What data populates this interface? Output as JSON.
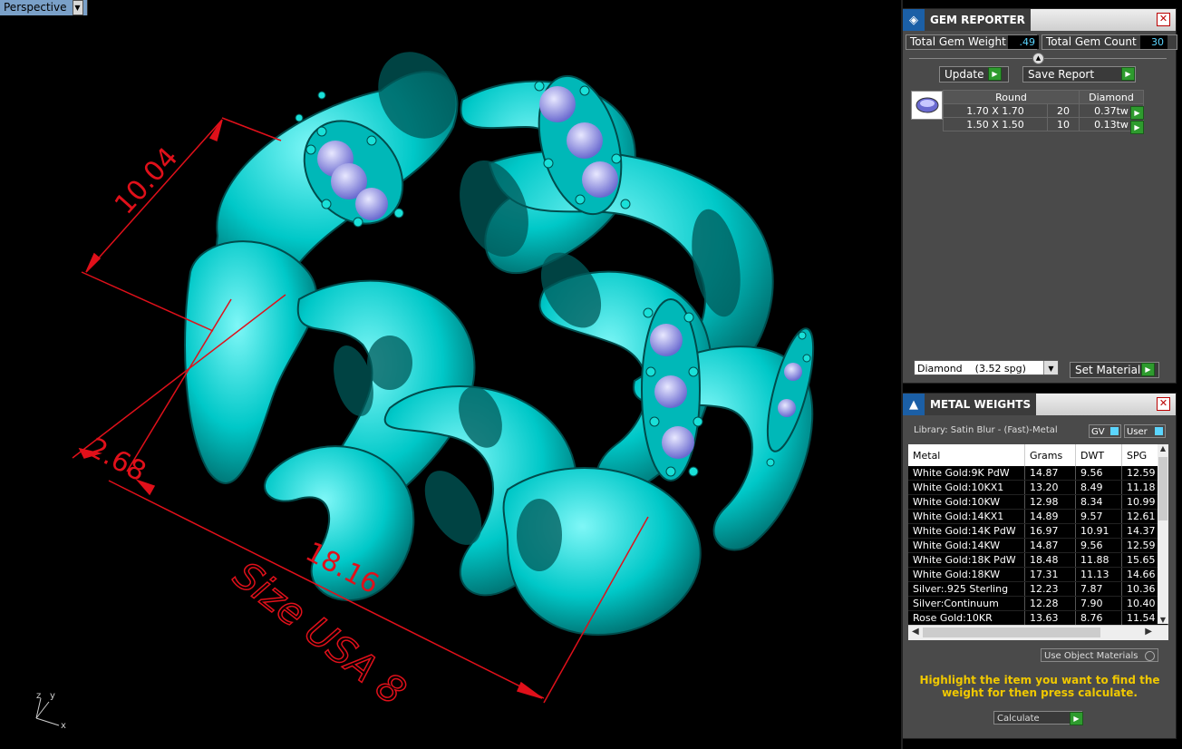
{
  "viewport": {
    "label": "Perspective",
    "dimensions": {
      "top": "10.04",
      "left": "2.68",
      "bottom": "18.16",
      "size": "Size USA 8"
    },
    "axes": {
      "x": "x",
      "y": "y",
      "z": "z"
    }
  },
  "gem_reporter": {
    "title": "GEM REPORTER",
    "total_weight_label": "Total Gem Weight",
    "total_weight_value": ".49",
    "total_count_label": "Total Gem Count",
    "total_count_value": "30",
    "update_label": "Update",
    "save_label": "Save Report",
    "table": {
      "headers": [
        "Round",
        "Diamond"
      ],
      "rows": [
        {
          "size": "1.70 X 1.70",
          "count": "20",
          "weight": "0.37tw"
        },
        {
          "size": "1.50 X 1.50",
          "count": "10",
          "weight": "0.13tw"
        }
      ]
    },
    "material_select": "Diamond    (3.52 spg)",
    "set_material_label": "Set Material"
  },
  "metal_weights": {
    "title": "METAL WEIGHTS",
    "library": "Library: Satin Blur - (Fast)-Metal",
    "gv_label": "GV",
    "user_label": "User",
    "columns": [
      "Metal",
      "Grams",
      "DWT",
      "SPG"
    ],
    "rows": [
      [
        "White Gold:9K PdW",
        "14.87",
        "9.56",
        "12.59"
      ],
      [
        "White Gold:10KX1",
        "13.20",
        "8.49",
        "11.18"
      ],
      [
        "White Gold:10KW",
        "12.98",
        "8.34",
        "10.99"
      ],
      [
        "White Gold:14KX1",
        "14.89",
        "9.57",
        "12.61"
      ],
      [
        "White Gold:14K PdW",
        "16.97",
        "10.91",
        "14.37"
      ],
      [
        "White Gold:14KW",
        "14.87",
        "9.56",
        "12.59"
      ],
      [
        "White Gold:18K PdW",
        "18.48",
        "11.88",
        "15.65"
      ],
      [
        "White Gold:18KW",
        "17.31",
        "11.13",
        "14.66"
      ],
      [
        "Silver:.925 Sterling",
        "12.23",
        "7.87",
        "10.36"
      ],
      [
        "Silver:Continuum",
        "12.28",
        "7.90",
        "10.40"
      ],
      [
        "Rose Gold:10KR",
        "13.63",
        "8.76",
        "11.54"
      ]
    ],
    "use_object_materials": "Use Object Materials",
    "hint": "Highlight the item you want to find the weight for then press calculate.",
    "calculate_label": "Calculate"
  }
}
